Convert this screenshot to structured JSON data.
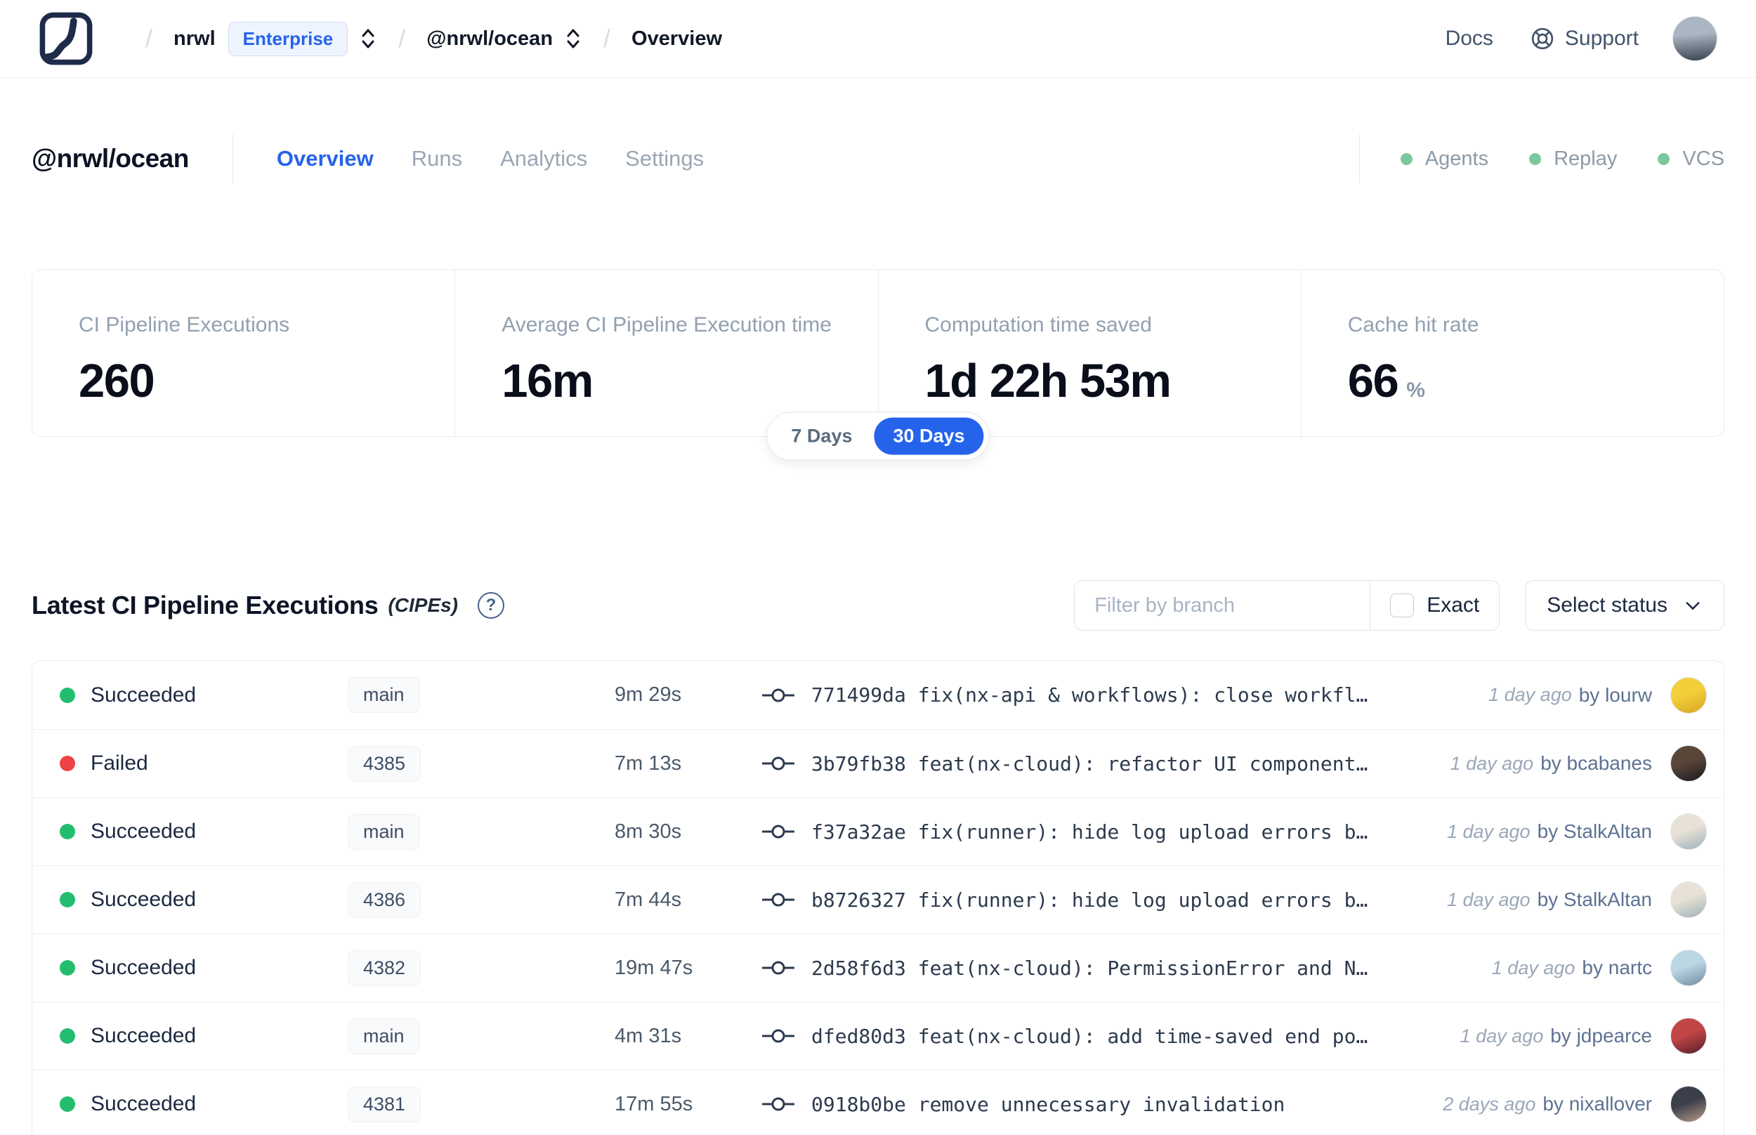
{
  "nav": {
    "breadcrumb": {
      "org": "nrwl",
      "org_badge": "Enterprise",
      "workspace": "@nrwl/ocean",
      "page": "Overview"
    },
    "links": {
      "docs": "Docs",
      "support": "Support"
    },
    "avatar_colors": [
      "#aab6c2",
      "#39424e"
    ]
  },
  "header": {
    "workspace": "@nrwl/ocean",
    "tabs": [
      {
        "label": "Overview",
        "active": true
      },
      {
        "label": "Runs",
        "active": false
      },
      {
        "label": "Analytics",
        "active": false
      },
      {
        "label": "Settings",
        "active": false
      }
    ],
    "services": [
      {
        "label": "Agents",
        "status_color": "#7cc89d"
      },
      {
        "label": "Replay",
        "status_color": "#7cc89d"
      },
      {
        "label": "VCS",
        "status_color": "#7cc89d"
      }
    ]
  },
  "stats": {
    "cards": [
      {
        "label": "CI Pipeline Executions",
        "value": "260",
        "suffix": ""
      },
      {
        "label": "Average CI Pipeline Execution time",
        "value": "16m",
        "suffix": ""
      },
      {
        "label": "Computation time saved",
        "value": "1d 22h 53m",
        "suffix": ""
      },
      {
        "label": "Cache hit rate",
        "value": "66",
        "suffix": "%"
      }
    ]
  },
  "range_toggle": {
    "options": [
      {
        "label": "7 Days",
        "active": false
      },
      {
        "label": "30 Days",
        "active": true
      }
    ],
    "active_color": "#2563eb"
  },
  "cipe_section": {
    "title": "Latest CI Pipeline Executions",
    "title_suffix": "(CIPEs)",
    "filter_placeholder": "Filter by branch",
    "exact_label": "Exact",
    "select_status_label": "Select status"
  },
  "table": {
    "status_colors": {
      "Succeeded": "#23bd6f",
      "Failed": "#ee4245"
    },
    "rows": [
      {
        "status": "Succeeded",
        "branch": "main",
        "duration": "9m 29s",
        "commit": "771499da fix(nx-api & workflows): close workfl…",
        "time": "1 day ago",
        "author": "by lourw",
        "avatar_colors": [
          "#f3cf3a",
          "#d7a622"
        ]
      },
      {
        "status": "Failed",
        "branch": "4385",
        "duration": "7m 13s",
        "commit": "3b79fb38 feat(nx-cloud): refactor UI component…",
        "time": "1 day ago",
        "author": "by bcabanes",
        "avatar_colors": [
          "#5a4638",
          "#171a20"
        ]
      },
      {
        "status": "Succeeded",
        "branch": "main",
        "duration": "8m 30s",
        "commit": "f37a32ae fix(runner): hide log upload errors b…",
        "time": "1 day ago",
        "author": "by StalkAltan",
        "avatar_colors": [
          "#e8e2d6",
          "#9fb0ba"
        ]
      },
      {
        "status": "Succeeded",
        "branch": "4386",
        "duration": "7m 44s",
        "commit": "b8726327 fix(runner): hide log upload errors b…",
        "time": "1 day ago",
        "author": "by StalkAltan",
        "avatar_colors": [
          "#e8e2d6",
          "#9fb0ba"
        ]
      },
      {
        "status": "Succeeded",
        "branch": "4382",
        "duration": "19m 47s",
        "commit": "2d58f6d3 feat(nx-cloud): PermissionError and N…",
        "time": "1 day ago",
        "author": "by nartc",
        "avatar_colors": [
          "#bcd7e4",
          "#6e8ba0"
        ]
      },
      {
        "status": "Succeeded",
        "branch": "main",
        "duration": "4m 31s",
        "commit": "dfed80d3 feat(nx-cloud): add time-saved end po…",
        "time": "1 day ago",
        "author": "by jdpearce",
        "avatar_colors": [
          "#c24646",
          "#571f2a"
        ]
      },
      {
        "status": "Succeeded",
        "branch": "4381",
        "duration": "17m 55s",
        "commit": "0918b0be remove unnecessary invalidation",
        "time": "2 days ago",
        "author": "by nixallover",
        "avatar_colors": [
          "#3a3f4a",
          "#b99a86"
        ]
      }
    ]
  }
}
